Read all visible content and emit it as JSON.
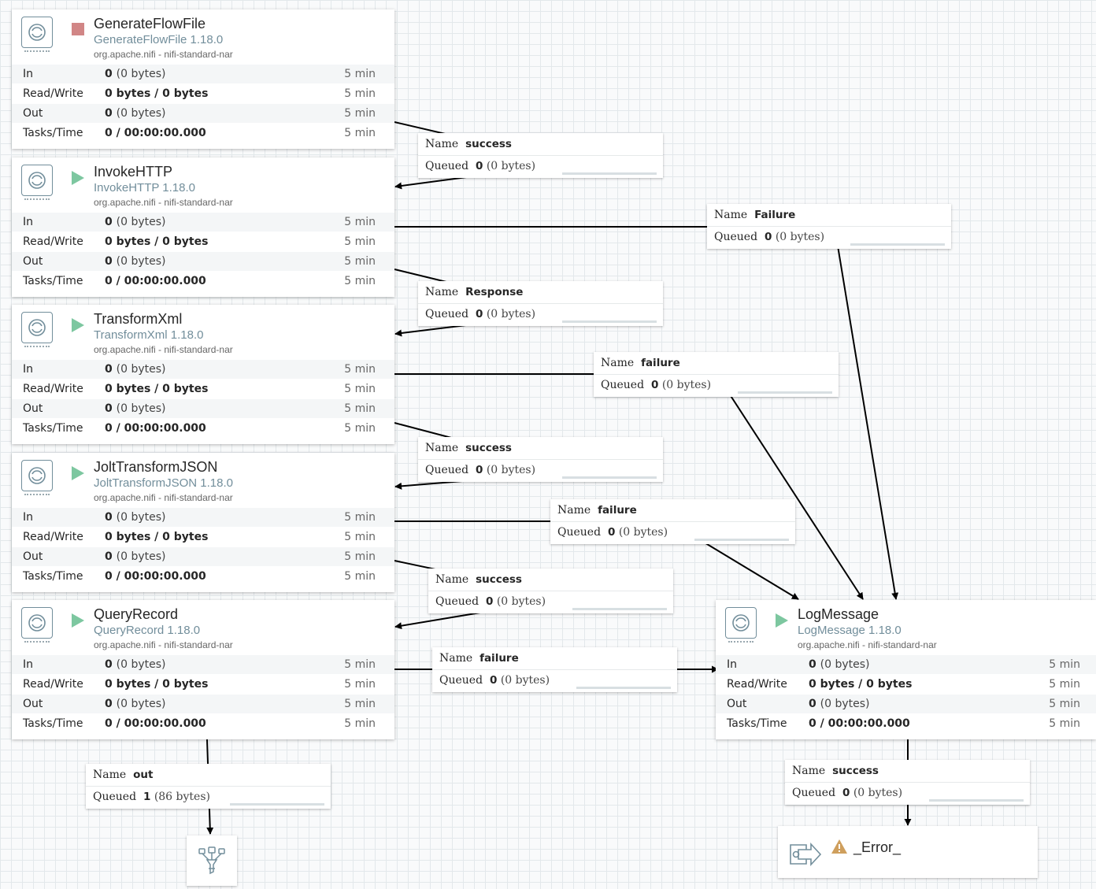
{
  "processors": [
    {
      "name": "GenerateFlowFile",
      "type": "GenerateFlowFile 1.18.0",
      "bundle": "org.apache.nifi - nifi-standard-nar",
      "state": "stopped",
      "stats": {
        "in_label": "In",
        "in_count": "0",
        "in_bytes": "(0 bytes)",
        "in_time": "5 min",
        "rw_label": "Read/Write",
        "rw_value": "0 bytes / 0 bytes",
        "rw_time": "5 min",
        "out_label": "Out",
        "out_count": "0",
        "out_bytes": "(0 bytes)",
        "out_time": "5 min",
        "tasks_label": "Tasks/Time",
        "tasks_value": "0 / 00:00:00.000",
        "tasks_time": "5 min"
      }
    },
    {
      "name": "InvokeHTTP",
      "type": "InvokeHTTP 1.18.0",
      "bundle": "org.apache.nifi - nifi-standard-nar",
      "state": "running",
      "stats": {
        "in_label": "In",
        "in_count": "0",
        "in_bytes": "(0 bytes)",
        "in_time": "5 min",
        "rw_label": "Read/Write",
        "rw_value": "0 bytes / 0 bytes",
        "rw_time": "5 min",
        "out_label": "Out",
        "out_count": "0",
        "out_bytes": "(0 bytes)",
        "out_time": "5 min",
        "tasks_label": "Tasks/Time",
        "tasks_value": "0 / 00:00:00.000",
        "tasks_time": "5 min"
      }
    },
    {
      "name": "TransformXml",
      "type": "TransformXml 1.18.0",
      "bundle": "org.apache.nifi - nifi-standard-nar",
      "state": "running",
      "stats": {
        "in_label": "In",
        "in_count": "0",
        "in_bytes": "(0 bytes)",
        "in_time": "5 min",
        "rw_label": "Read/Write",
        "rw_value": "0 bytes / 0 bytes",
        "rw_time": "5 min",
        "out_label": "Out",
        "out_count": "0",
        "out_bytes": "(0 bytes)",
        "out_time": "5 min",
        "tasks_label": "Tasks/Time",
        "tasks_value": "0 / 00:00:00.000",
        "tasks_time": "5 min"
      }
    },
    {
      "name": "JoltTransformJSON",
      "type": "JoltTransformJSON 1.18.0",
      "bundle": "org.apache.nifi - nifi-standard-nar",
      "state": "running",
      "stats": {
        "in_label": "In",
        "in_count": "0",
        "in_bytes": "(0 bytes)",
        "in_time": "5 min",
        "rw_label": "Read/Write",
        "rw_value": "0 bytes / 0 bytes",
        "rw_time": "5 min",
        "out_label": "Out",
        "out_count": "0",
        "out_bytes": "(0 bytes)",
        "out_time": "5 min",
        "tasks_label": "Tasks/Time",
        "tasks_value": "0 / 00:00:00.000",
        "tasks_time": "5 min"
      }
    },
    {
      "name": "QueryRecord",
      "type": "QueryRecord 1.18.0",
      "bundle": "org.apache.nifi - nifi-standard-nar",
      "state": "running",
      "stats": {
        "in_label": "In",
        "in_count": "0",
        "in_bytes": "(0 bytes)",
        "in_time": "5 min",
        "rw_label": "Read/Write",
        "rw_value": "0 bytes / 0 bytes",
        "rw_time": "5 min",
        "out_label": "Out",
        "out_count": "0",
        "out_bytes": "(0 bytes)",
        "out_time": "5 min",
        "tasks_label": "Tasks/Time",
        "tasks_value": "0 / 00:00:00.000",
        "tasks_time": "5 min"
      }
    },
    {
      "name": "LogMessage",
      "type": "LogMessage 1.18.0",
      "bundle": "org.apache.nifi - nifi-standard-nar",
      "state": "running",
      "stats": {
        "in_label": "In",
        "in_count": "0",
        "in_bytes": "(0 bytes)",
        "in_time": "5 min",
        "rw_label": "Read/Write",
        "rw_value": "0 bytes / 0 bytes",
        "rw_time": "5 min",
        "out_label": "Out",
        "out_count": "0",
        "out_bytes": "(0 bytes)",
        "out_time": "5 min",
        "tasks_label": "Tasks/Time",
        "tasks_value": "0 / 00:00:00.000",
        "tasks_time": "5 min"
      }
    }
  ],
  "connections": [
    {
      "name_label": "Name",
      "name": "success",
      "queued_label": "Queued",
      "count": "0",
      "bytes": "(0 bytes)"
    },
    {
      "name_label": "Name",
      "name": "Failure",
      "queued_label": "Queued",
      "count": "0",
      "bytes": "(0 bytes)"
    },
    {
      "name_label": "Name",
      "name": "Response",
      "queued_label": "Queued",
      "count": "0",
      "bytes": "(0 bytes)"
    },
    {
      "name_label": "Name",
      "name": "failure",
      "queued_label": "Queued",
      "count": "0",
      "bytes": "(0 bytes)"
    },
    {
      "name_label": "Name",
      "name": "success",
      "queued_label": "Queued",
      "count": "0",
      "bytes": "(0 bytes)"
    },
    {
      "name_label": "Name",
      "name": "failure",
      "queued_label": "Queued",
      "count": "0",
      "bytes": "(0 bytes)"
    },
    {
      "name_label": "Name",
      "name": "success",
      "queued_label": "Queued",
      "count": "0",
      "bytes": "(0 bytes)"
    },
    {
      "name_label": "Name",
      "name": "failure",
      "queued_label": "Queued",
      "count": "0",
      "bytes": "(0 bytes)"
    },
    {
      "name_label": "Name",
      "name": "out",
      "queued_label": "Queued",
      "count": "1",
      "bytes": "(86 bytes)"
    },
    {
      "name_label": "Name",
      "name": "success",
      "queued_label": "Queued",
      "count": "0",
      "bytes": "(0 bytes)"
    }
  ],
  "output_port": {
    "name": "_Error_",
    "icon": "output-port-icon",
    "warning_icon": "warning-icon"
  },
  "funnel": {
    "icon": "funnel-icon"
  },
  "colors": {
    "running": "#7dc7a0",
    "stopped": "#d18686",
    "accent": "#728e9b",
    "warning": "#cf9f5d"
  }
}
